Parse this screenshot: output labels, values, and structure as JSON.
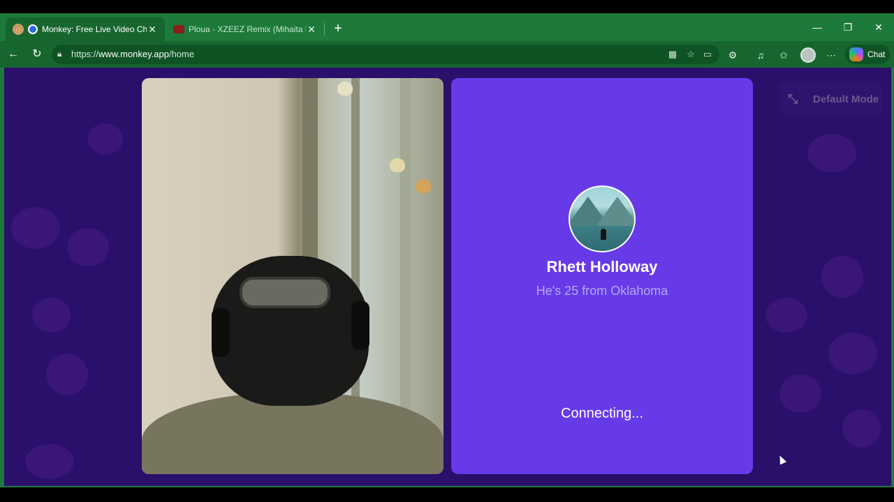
{
  "browser": {
    "tabs": [
      {
        "title": "Monkey: Free Live Video Chat",
        "favicon": "monkey-icon",
        "active": true
      },
      {
        "title": "Ploua - XZEEZ Remix (Mihaita Piticu",
        "favicon": "youtube-icon",
        "active": false
      }
    ],
    "url_prefix": "https://",
    "url_host": "www.monkey.app",
    "url_path": "/home",
    "chat_label": "Chat"
  },
  "page": {
    "mode_button_label": "Default Mode",
    "profile": {
      "name": "Rhett Holloway",
      "subtitle": "He's 25 from Oklahoma"
    },
    "status": "Connecting..."
  },
  "colors": {
    "browser_frame": "#1e7a3c",
    "background": "#2a0f6b",
    "remote_card": "#673ae8"
  }
}
